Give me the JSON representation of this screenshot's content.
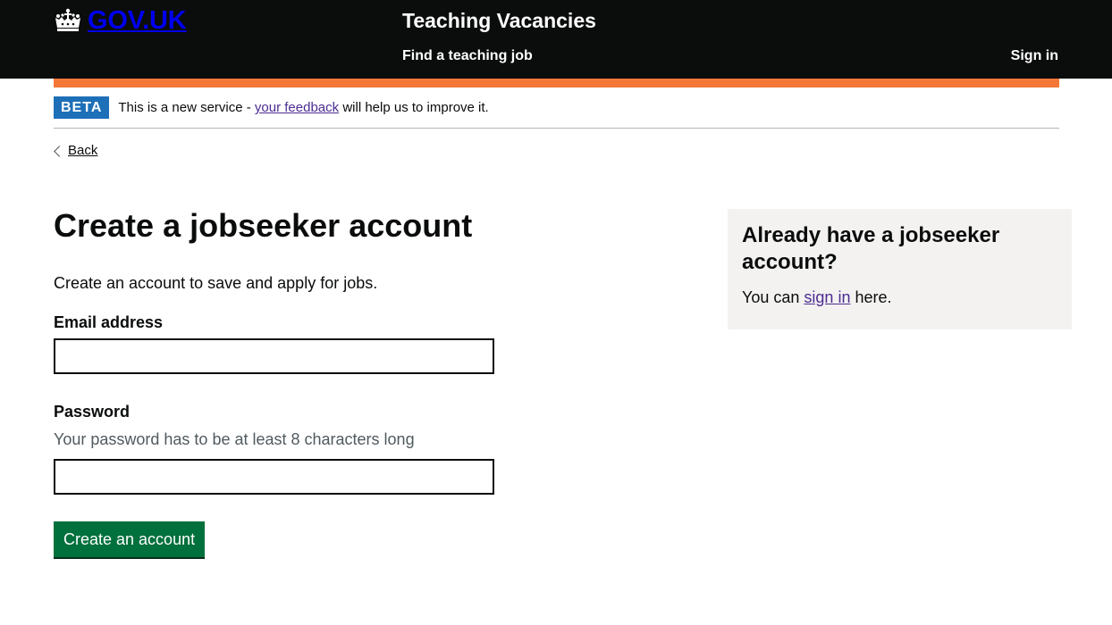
{
  "header": {
    "logo_text": "GOV.UK",
    "service_name": "Teaching Vacancies",
    "nav_find_job": "Find a teaching job",
    "sign_in": "Sign in"
  },
  "phase_banner": {
    "tag": "BETA",
    "text_before": "This is a new service -",
    "feedback_link": "your feedback",
    "text_after": "will help us to improve it."
  },
  "back_link": "Back",
  "main": {
    "title": "Create a jobseeker account",
    "lede": "Create an account to save and apply for jobs.",
    "email_label": "Email address",
    "email_value": "",
    "password_label": "Password",
    "password_hint": "Your password has to be at least 8 characters long",
    "password_value": "",
    "submit_label": "Create an account"
  },
  "aside": {
    "heading": "Already have a jobseeker account?",
    "text_before": "You can",
    "sign_in_link": "sign in",
    "text_after": "here."
  },
  "colors": {
    "header_bg": "#0b0c0c",
    "phase_bar": "#f47738",
    "beta_tag": "#1d70b8",
    "button": "#00703c",
    "visited_link": "#4c2c92",
    "aside_bg": "#f3f2f1"
  },
  "icons": {
    "logo": "crown-icon",
    "back": "chevron-left-icon"
  }
}
